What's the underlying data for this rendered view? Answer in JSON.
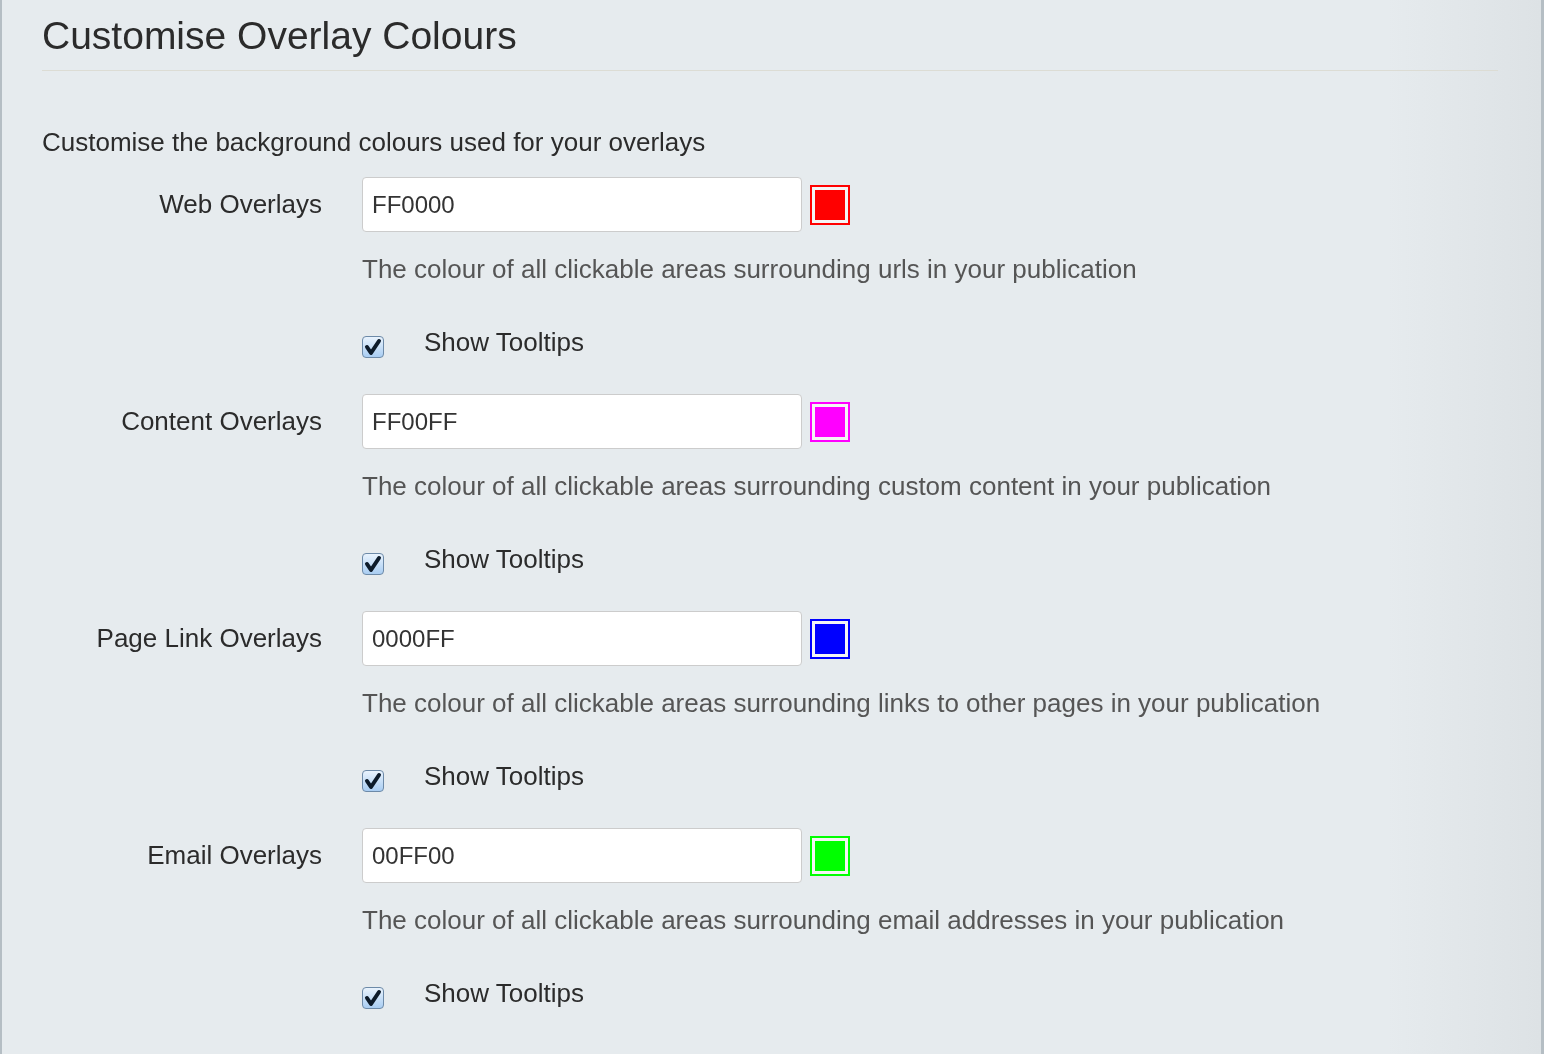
{
  "title": "Customise Overlay Colours",
  "intro": "Customise the background colours used for your overlays",
  "overlays": [
    {
      "label": "Web Overlays",
      "value": "FF0000",
      "color": "#ff0000",
      "help": "The colour of all clickable areas surrounding urls in your publication",
      "tooltip_label": "Show Tooltips",
      "checked": true
    },
    {
      "label": "Content Overlays",
      "value": "FF00FF",
      "color": "#ff00ff",
      "help": "The colour of all clickable areas surrounding custom content in your publication",
      "tooltip_label": "Show Tooltips",
      "checked": true
    },
    {
      "label": "Page Link Overlays",
      "value": "0000FF",
      "color": "#0000ff",
      "help": "The colour of all clickable areas surrounding links to other pages in your publication",
      "tooltip_label": "Show Tooltips",
      "checked": true
    },
    {
      "label": "Email Overlays",
      "value": "00FF00",
      "color": "#00ff00",
      "help": "The colour of all clickable areas surrounding email addresses in your publication",
      "tooltip_label": "Show Tooltips",
      "checked": true
    }
  ]
}
